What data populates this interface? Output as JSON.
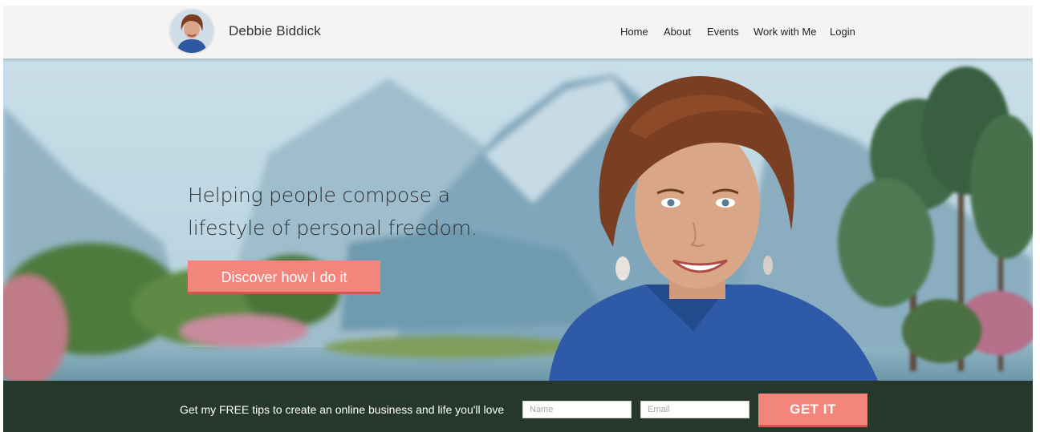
{
  "header": {
    "site_name": "Debbie Biddick",
    "nav": [
      {
        "label": "Home"
      },
      {
        "label": "About"
      },
      {
        "label": "Events"
      },
      {
        "label": "Work with Me"
      },
      {
        "label": "Login"
      }
    ]
  },
  "hero": {
    "headline_line1": "Helping people compose a",
    "headline_line2": "lifestyle of personal freedom.",
    "cta_label": "Discover how I do it"
  },
  "signup": {
    "text": "Get my FREE tips to create an online business and life you'll love",
    "name_placeholder": "Name",
    "email_placeholder": "Email",
    "submit_label": "GET IT"
  },
  "colors": {
    "accent": "#f4857d",
    "bar_background": "#26382c",
    "header_background": "#f5f4f2"
  }
}
